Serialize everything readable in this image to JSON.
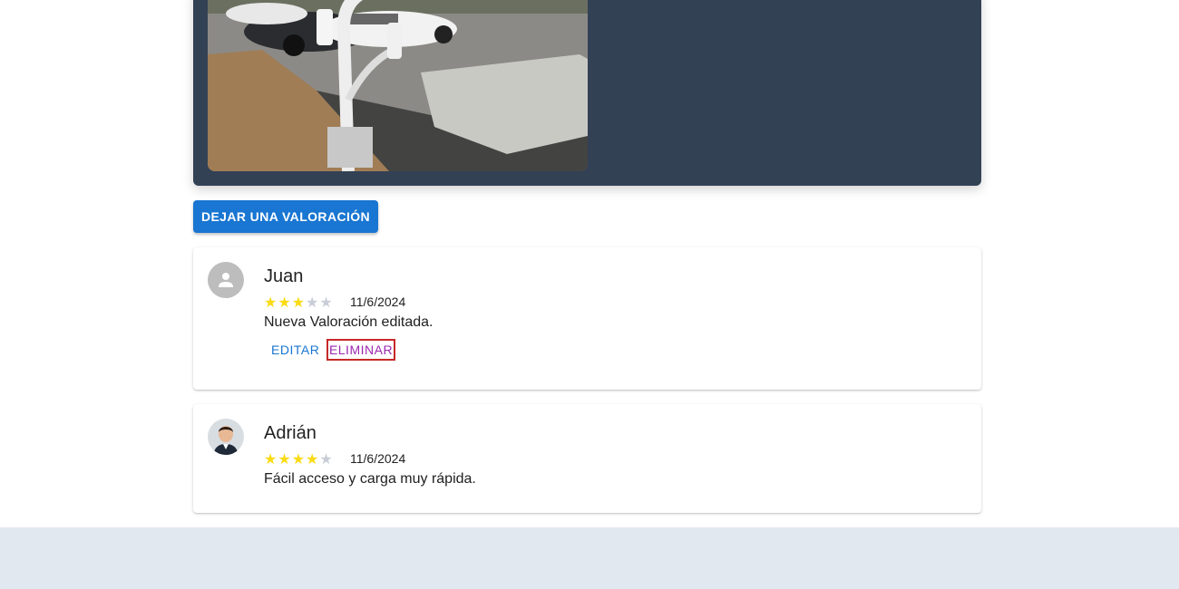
{
  "hero": {
    "photo_alt": ""
  },
  "actions": {
    "rate_button": "DEJAR UNA VALORACIÓN"
  },
  "reviews": [
    {
      "author": "Juan",
      "rating": 3,
      "max_rating": 5,
      "stars_on": "★★★",
      "stars_off": "★★",
      "date": "11/6/2024",
      "comment": "Nueva Valoración editada.",
      "edit_label": "EDITAR",
      "delete_label": "ELIMINAR",
      "avatar": "person-icon"
    },
    {
      "author": "Adrián",
      "rating": 4,
      "max_rating": 5,
      "stars_on": "★★★★",
      "stars_off": "★",
      "date": "11/6/2024",
      "comment": "Fácil acceso y carga muy rápida.",
      "avatar": "user-photo"
    }
  ],
  "colors": {
    "hero_bg": "#334155",
    "primary": "#1976d2",
    "secondary": "#9c27b0",
    "star": "#fadb14",
    "footer_bg": "#e2e8f0"
  }
}
